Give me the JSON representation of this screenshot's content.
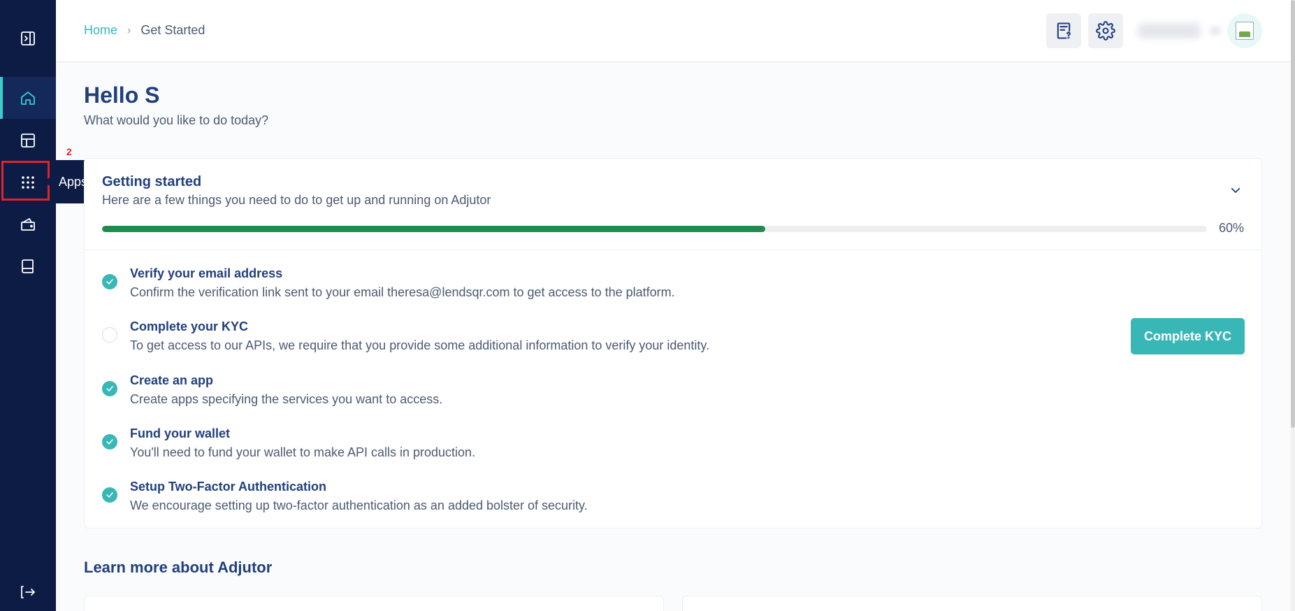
{
  "sidebar": {
    "items": [
      {
        "name": "collapse-sidebar-icon"
      },
      {
        "name": "home-icon",
        "active": true
      },
      {
        "name": "dashboard-icon"
      },
      {
        "name": "apps-grid-icon"
      },
      {
        "name": "wallet-icon"
      },
      {
        "name": "docs-book-icon"
      },
      {
        "name": "logout-icon"
      }
    ],
    "tooltip": "Apps",
    "annotation_number": "2"
  },
  "header": {
    "breadcrumb": {
      "home": "Home",
      "separator": "›",
      "current": "Get Started"
    },
    "icons": [
      "help-document-icon",
      "settings-gear-icon"
    ]
  },
  "greeting": {
    "title": "Hello S",
    "subtitle": "What would you like to do today?"
  },
  "getting_started": {
    "title": "Getting started",
    "subtitle": "Here are a few things you need to do to get up and running on Adjutor",
    "progress_percent": 60,
    "progress_label": "60%",
    "progress_color": "#1f8b4c",
    "tasks": [
      {
        "title": "Verify your email address",
        "description": "Confirm the verification link sent to your email theresa@lendsqr.com to get access to the platform.",
        "done": true
      },
      {
        "title": "Complete your KYC",
        "description": "To get access to our APIs, we require that you provide some additional information to verify your identity.",
        "done": false
      },
      {
        "title": "Create an app",
        "description": "Create apps specifying the services you want to access.",
        "done": true
      },
      {
        "title": "Fund your wallet",
        "description": "You'll need to fund your wallet to make API calls in production.",
        "done": true
      },
      {
        "title": "Setup Two-Factor Authentication",
        "description": "We encourage setting up two-factor authentication as an added bolster of security.",
        "done": true
      }
    ],
    "kyc_button": "Complete KYC"
  },
  "learn_more": {
    "title": "Learn more about Adjutor"
  },
  "colors": {
    "sidebar": "#0d1c45",
    "accent": "#39b7b6",
    "text": "#213f7d",
    "highlight": "#e0222b"
  }
}
